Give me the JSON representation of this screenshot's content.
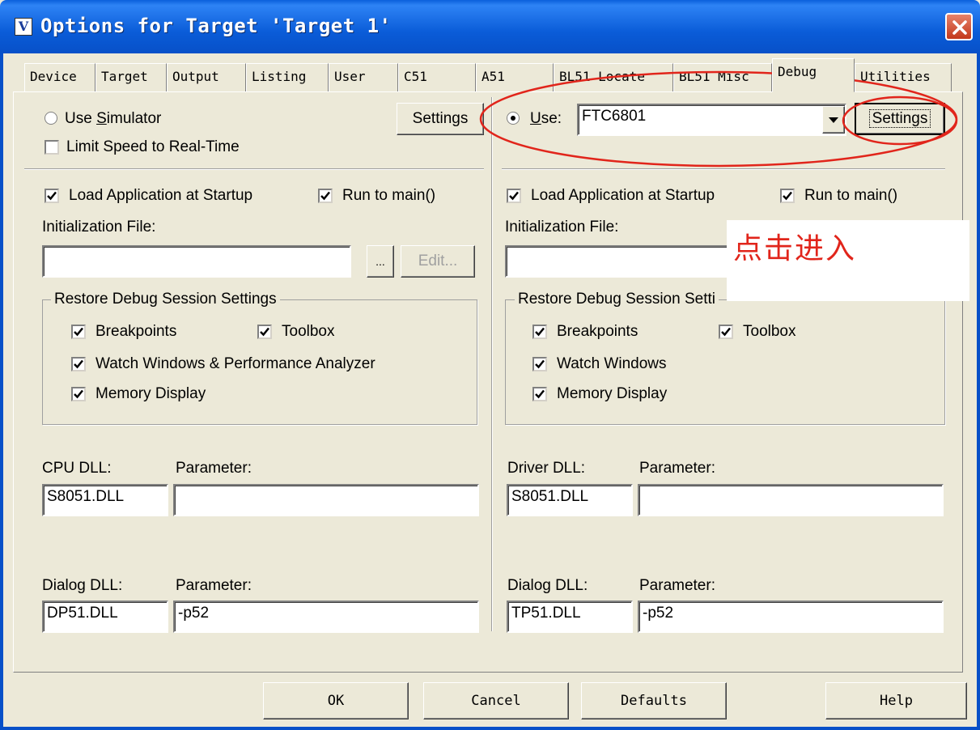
{
  "window": {
    "title": "Options for Target 'Target 1'",
    "title_icon": "V"
  },
  "tabs": [
    {
      "label": "Device",
      "active": false
    },
    {
      "label": "Target",
      "active": false
    },
    {
      "label": "Output",
      "active": false
    },
    {
      "label": "Listing",
      "active": false
    },
    {
      "label": "User",
      "active": false
    },
    {
      "label": "C51",
      "active": false
    },
    {
      "label": "A51",
      "active": false
    },
    {
      "label": "BL51 Locate",
      "active": false
    },
    {
      "label": "BL51 Misc",
      "active": false
    },
    {
      "label": "Debug",
      "active": true
    },
    {
      "label": "Utilities",
      "active": false
    }
  ],
  "left": {
    "use_simulator": {
      "pre": "Use ",
      "key": "S",
      "post": "imulator",
      "checked": false
    },
    "limit_speed": {
      "label": "Limit Speed to Real-Time",
      "checked": false
    },
    "settings_label": "Settings",
    "load_app": {
      "label": "Load Application at Startup",
      "checked": true
    },
    "run_to_main": {
      "label": "Run to main()",
      "checked": true
    },
    "init_file_label": "Initialization File:",
    "init_file_value": "",
    "browse_label": "...",
    "edit_label": "Edit...",
    "restore_group": "Restore Debug Session Settings",
    "breakpoints": {
      "label": "Breakpoints",
      "checked": true
    },
    "toolbox": {
      "label": "Toolbox",
      "checked": true
    },
    "watch": {
      "label": "Watch Windows & Performance Analyzer",
      "checked": true
    },
    "memory": {
      "label": "Memory Display",
      "checked": true
    },
    "cpu_dll_label": "CPU DLL:",
    "cpu_param_label": "Parameter:",
    "cpu_dll_value": "S8051.DLL",
    "cpu_param_value": "",
    "dialog_dll_label": "Dialog DLL:",
    "dialog_param_label": "Parameter:",
    "dialog_dll_value": "DP51.DLL",
    "dialog_param_value": "-p52"
  },
  "right": {
    "use": {
      "key": "U",
      "post": "se:",
      "checked": true
    },
    "driver_value": "FTC6801",
    "settings_label": "Settings",
    "load_app": {
      "label": "Load Application at Startup",
      "checked": true
    },
    "run_to_main": {
      "label": "Run to main()",
      "checked": true
    },
    "init_file_label": "Initialization File:",
    "init_file_value": "",
    "restore_group": "Restore Debug Session Setti",
    "breakpoints": {
      "label": "Breakpoints",
      "checked": true
    },
    "toolbox": {
      "label": "Toolbox",
      "checked": true
    },
    "watch": {
      "label": "Watch Windows",
      "checked": true
    },
    "memory": {
      "label": "Memory Display",
      "checked": true
    },
    "driver_dll_label": "Driver DLL:",
    "driver_param_label": "Parameter:",
    "driver_dll_value": "S8051.DLL",
    "driver_param_value": "",
    "dialog_dll_label": "Dialog DLL:",
    "dialog_param_label": "Parameter:",
    "dialog_dll_value": "TP51.DLL",
    "dialog_param_value": "-p52"
  },
  "annotation": {
    "text": "点击进入",
    "color": "#E1251B"
  },
  "footer": {
    "ok": "OK",
    "cancel": "Cancel",
    "defaults": "Defaults",
    "help": "Help"
  },
  "colors": {
    "face": "#ECE9D8",
    "titlebar": "#0A5CD8",
    "annotation": "#E1251B"
  }
}
